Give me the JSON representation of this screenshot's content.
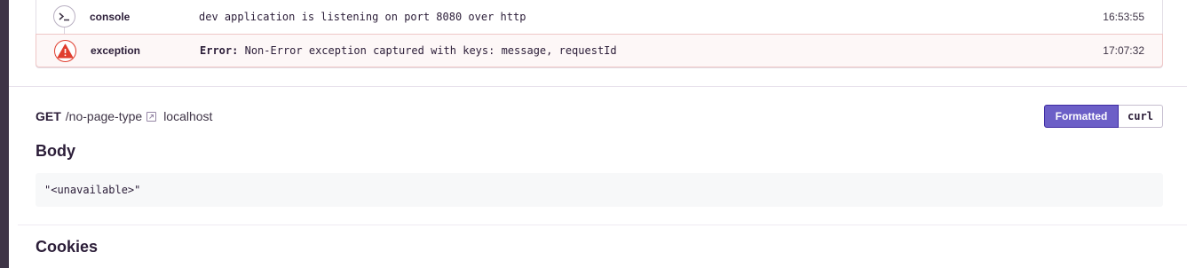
{
  "breadcrumbs": [
    {
      "icon": "terminal-icon",
      "type": "console",
      "message": "dev application is listening on port 8080 over http",
      "time": "16:53:55"
    },
    {
      "icon": "warning-icon",
      "type": "exception",
      "message_prefix": "Error:",
      "message": "Non-Error exception captured with keys: message, requestId",
      "time": "17:07:32"
    }
  ],
  "request": {
    "method": "GET",
    "path": "/no-page-type",
    "host": "localhost"
  },
  "toggle": {
    "formatted_label": "Formatted",
    "curl_label": "curl",
    "selected": "Formatted"
  },
  "body": {
    "title": "Body",
    "value": "\"<unavailable>\""
  },
  "cookies": {
    "title": "Cookies"
  },
  "colors": {
    "accent": "#6c5fc7",
    "error": "#e03e2f",
    "sidebar": "#3e3446"
  }
}
